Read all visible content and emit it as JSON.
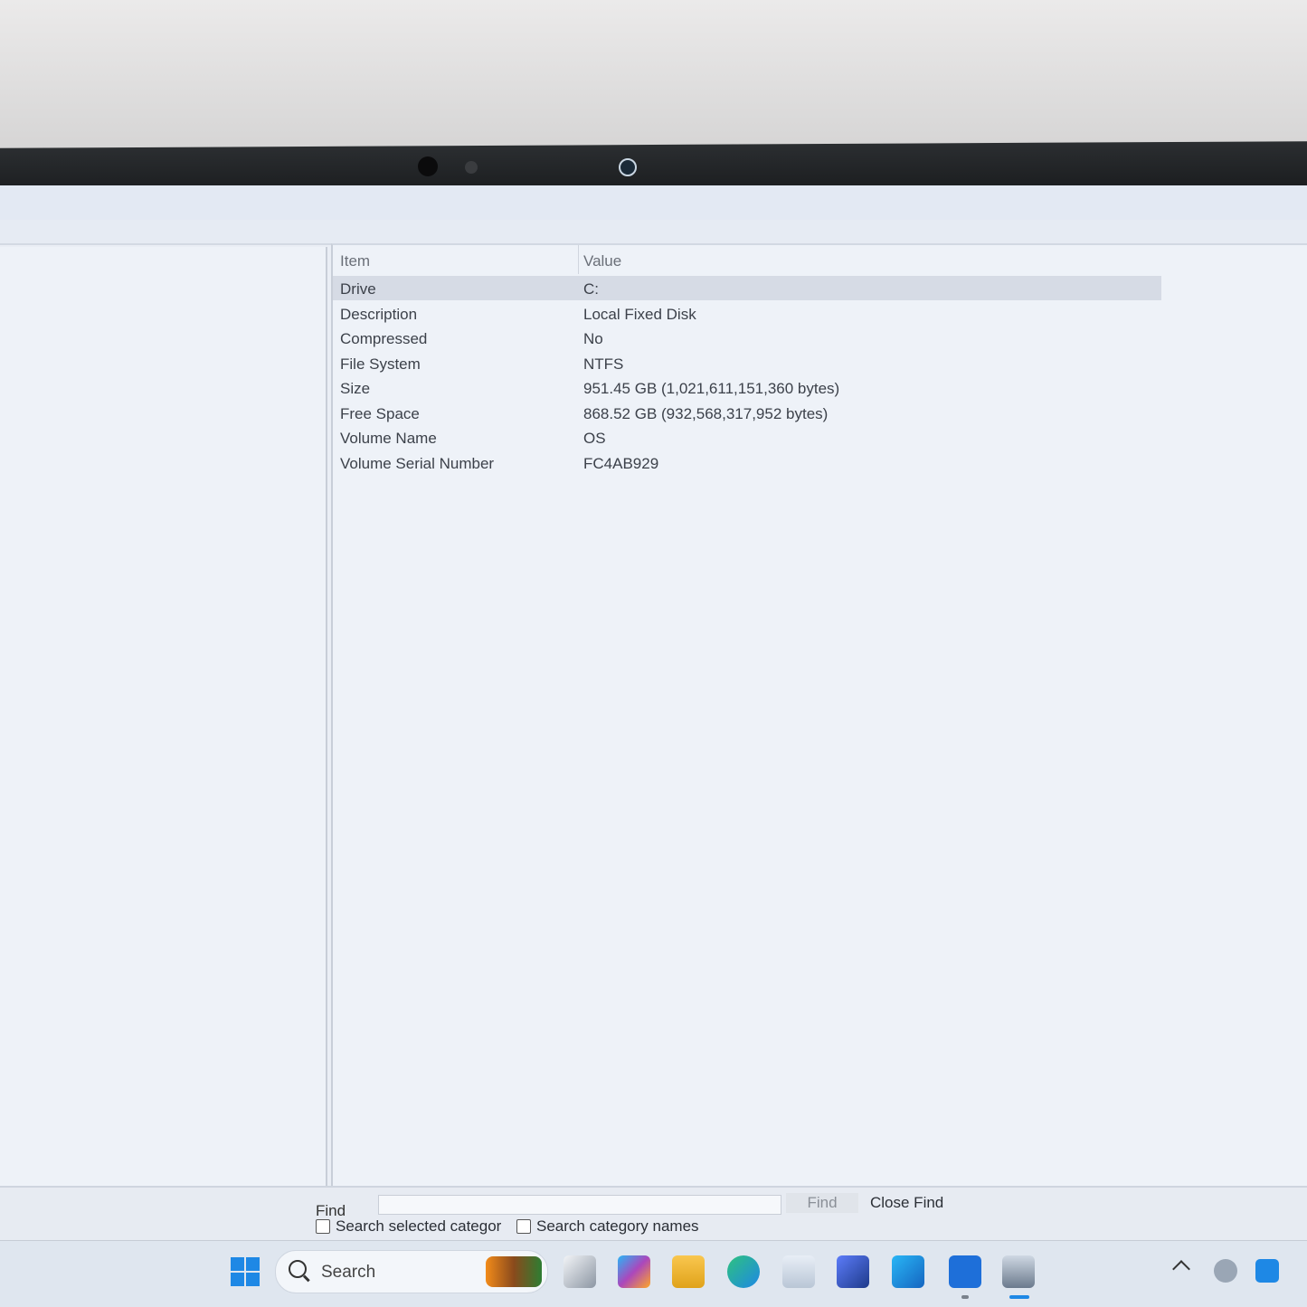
{
  "table": {
    "headers": {
      "item": "Item",
      "value": "Value"
    },
    "rows": [
      {
        "item": "Drive",
        "value": "C:"
      },
      {
        "item": "Description",
        "value": "Local Fixed Disk"
      },
      {
        "item": "Compressed",
        "value": "No"
      },
      {
        "item": "File System",
        "value": "NTFS"
      },
      {
        "item": "Size",
        "value": "951.45 GB (1,021,611,151,360 bytes)"
      },
      {
        "item": "Free Space",
        "value": "868.52 GB (932,568,317,952 bytes)"
      },
      {
        "item": "Volume Name",
        "value": "OS"
      },
      {
        "item": "Volume Serial Number",
        "value": "FC4AB929"
      }
    ],
    "selected_row": 0
  },
  "find": {
    "label": "Find",
    "input_value": "",
    "find_button": "Find",
    "close_button": "Close Find",
    "search_selected_category": "Search selected categor",
    "search_category_names": "Search category names",
    "search_selected_category_checked": false,
    "search_category_names_checked": false
  },
  "taskbar": {
    "search_placeholder": "Search",
    "apps": [
      "windows-start-icon",
      "search-icon",
      "task-view-icon",
      "m365-copilot-icon",
      "file-explorer-icon",
      "edge-icon",
      "microsoft-store-icon",
      "power-automate-icon",
      "outlook-icon",
      "dell-optimizer-icon",
      "system-information-icon"
    ],
    "tray": [
      "show-hidden-icons-chevron",
      "onedrive-icon",
      "app-tray-icon"
    ]
  },
  "colors": {
    "accent": "#1e88e5",
    "selected_row": "#d6dbe5",
    "screen_bg": "#eaeef5"
  }
}
